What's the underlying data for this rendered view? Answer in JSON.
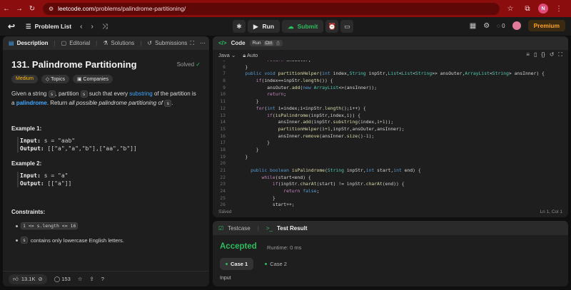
{
  "browser": {
    "url_domain": "leetcode.com",
    "url_path": "/problems/palindrome-partitioning/",
    "profile_initial": "N"
  },
  "topbar": {
    "problem_list": "Problem List",
    "run": "Run",
    "submit": "Submit",
    "streak": "0",
    "premium": "Premium"
  },
  "left": {
    "tabs": [
      "Description",
      "Editorial",
      "Solutions",
      "Submissions"
    ],
    "title": "131. Palindrome Partitioning",
    "solved": "Solved",
    "chips": [
      "Medium",
      "Topics",
      "Companies"
    ],
    "desc": {
      "p1": "Given a string",
      "s": "s",
      "p2": ", partition",
      "p3": "such that every",
      "substring": "substring",
      "p4": "of the partition is a",
      "palindrome": "palindrome",
      "p5": ". Return",
      "p6": "all possible palindrome partitioning of",
      "p7": "."
    },
    "example1_title": "Example 1:",
    "example1_input_label": "Input:",
    "example1_input": "s = \"aab\"",
    "example1_output_label": "Output:",
    "example1_output": "[[\"a\",\"a\",\"b\"],[\"aa\",\"b\"]]",
    "example2_title": "Example 2:",
    "example2_input_label": "Input:",
    "example2_input": "s = \"a\"",
    "example2_output_label": "Output:",
    "example2_output": "[[\"a\"]]",
    "constraints_title": "Constraints:",
    "constraint1": "1 <= s.length <= 16",
    "constraint2_code": "s",
    "constraint2_text": "contains only lowercase English letters.",
    "likes": "13.1K",
    "comments": "153"
  },
  "code": {
    "tab": "Code",
    "run_tip": "Run",
    "run_kbd": "Ctrl",
    "run_kbd2": "'",
    "language": "Java",
    "mode": "Auto",
    "saved": "Saved",
    "cursor": "Ln 1, Col 1",
    "lines": [
      {
        "n": "5",
        "t": "            return ansOuter;"
      },
      {
        "n": "6",
        "t": "    }"
      },
      {
        "n": "7",
        "t": "    public void partitionHelper(int index,String inpStr,List<List<String>> ansOuter,ArrayList<String> ansInner) {"
      },
      {
        "n": "8",
        "t": "        if(index==inpStr.length()) {"
      },
      {
        "n": "9",
        "t": "            ansOuter.add(new ArrayList<>(ansInner));"
      },
      {
        "n": "10",
        "t": "            return;"
      },
      {
        "n": "11",
        "t": "        }"
      },
      {
        "n": "12",
        "t": "        for(int i=index;i<inpStr.length();i++) {"
      },
      {
        "n": "13",
        "t": "            if(isPalindrome(inpStr,index,i)) {"
      },
      {
        "n": "14",
        "t": "                ansInner.add(inpStr.substring(index,i+1));"
      },
      {
        "n": "15",
        "t": "                partitionHelper(i+1,inpStr,ansOuter,ansInner);"
      },
      {
        "n": "16",
        "t": "                ansInner.remove(ansInner.size()-1);"
      },
      {
        "n": "17",
        "t": "            }"
      },
      {
        "n": "18",
        "t": "        }"
      },
      {
        "n": "19",
        "t": "    }"
      },
      {
        "n": "20",
        "t": ""
      },
      {
        "n": "21",
        "t": "      public boolean isPalindrome(String inpStr,int start,int end) {"
      },
      {
        "n": "22",
        "t": "          while(start<end) {"
      },
      {
        "n": "23",
        "t": "              if(inpStr.charAt(start) != inpStr.charAt(end)) {"
      },
      {
        "n": "24",
        "t": "                  return false;"
      },
      {
        "n": "25",
        "t": "              }"
      },
      {
        "n": "26",
        "t": "              start++;"
      },
      {
        "n": "27",
        "t": "              end--;"
      }
    ]
  },
  "result": {
    "tabs": [
      "Testcase",
      "Test Result"
    ],
    "status": "Accepted",
    "runtime": "Runtime: 0 ms",
    "cases": [
      "Case 1",
      "Case 2"
    ],
    "input_label": "Input"
  },
  "colors": {
    "accent": "#2cbb5d",
    "premium": "#ffa116",
    "chrome": "#8b0d0d"
  }
}
